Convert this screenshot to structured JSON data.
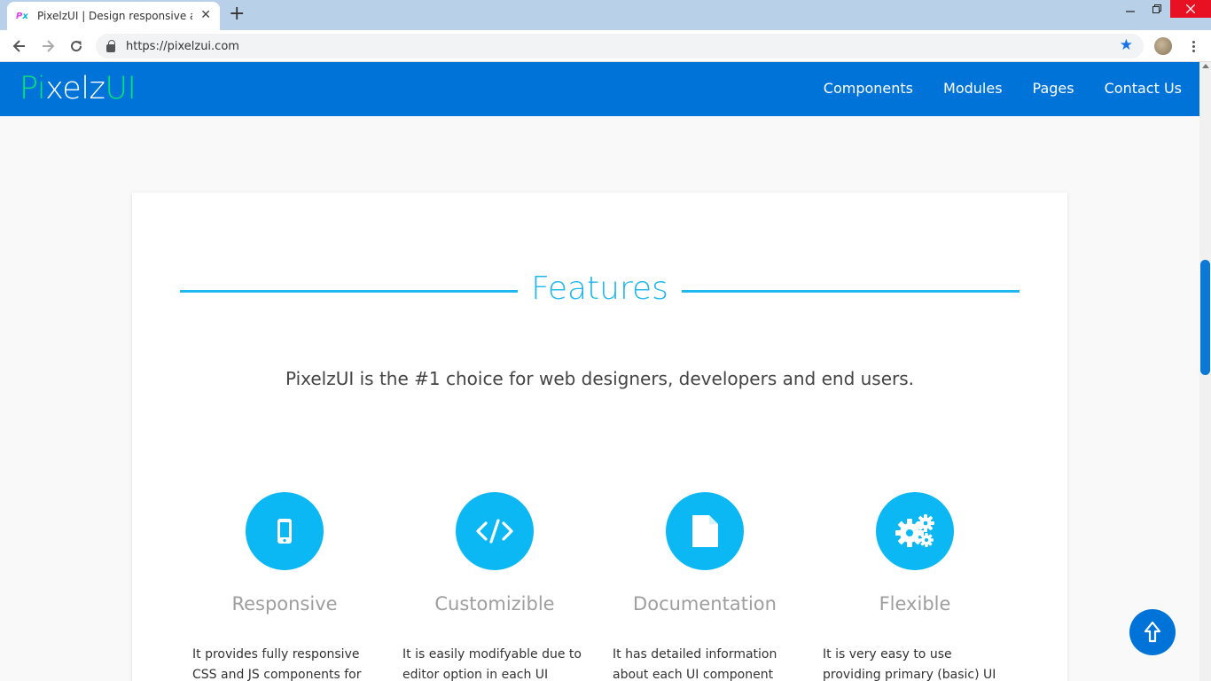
{
  "browser": {
    "tab_title": "PixelzUI | Design responsive and",
    "favicon_p": "P",
    "favicon_x": "x",
    "url": "https://pixelzui.com"
  },
  "header": {
    "logo_start": "Pi",
    "logo_mid": "xelz",
    "logo_end": "UI",
    "nav": [
      "Components",
      "Modules",
      "Pages",
      "Contact Us"
    ]
  },
  "features_section": {
    "heading": "Features",
    "tagline": "PixelzUI is the #1 choice for web designers, developers and end users.",
    "items": [
      {
        "icon": "mobile-icon",
        "title": "Responsive",
        "desc": "It provides fully responsive CSS and JS components for"
      },
      {
        "icon": "code-icon",
        "title": "Customizible",
        "desc": "It is easily modifyable due to editor option in each UI"
      },
      {
        "icon": "document-icon",
        "title": "Documentation",
        "desc": "It has detailed information about each UI component"
      },
      {
        "icon": "gears-icon",
        "title": "Flexible",
        "desc": "It is very easy to use providing primary (basic) UI"
      }
    ]
  },
  "colors": {
    "header_blue": "#0073d9",
    "accent_cyan": "#1eb7f0",
    "logo_green": "#00e676"
  }
}
